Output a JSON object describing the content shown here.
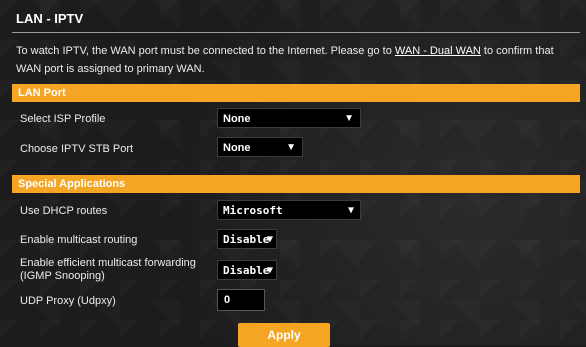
{
  "page": {
    "title": "LAN - IPTV",
    "description_prefix": "To watch IPTV, the WAN port must be connected to the Internet. Please go to ",
    "description_link": "WAN - Dual WAN",
    "description_suffix": " to confirm that WAN port is assigned to primary WAN."
  },
  "lan_port": {
    "heading": "LAN Port",
    "isp_profile": {
      "label": "Select ISP Profile",
      "value": "None"
    },
    "stb_port": {
      "label": "Choose IPTV STB Port",
      "value": "None"
    }
  },
  "special": {
    "heading": "Special Applications",
    "dhcp_routes": {
      "label": "Use DHCP routes",
      "value": "Microsoft"
    },
    "multicast_routing": {
      "label": "Enable multicast routing",
      "value": "Disable"
    },
    "igmp_snooping": {
      "label": "Enable efficient multicast forwarding (IGMP Snooping)",
      "value": "Disable"
    },
    "udp_proxy": {
      "label": "UDP Proxy (Udpxy)",
      "value": "0"
    }
  },
  "apply_label": "Apply",
  "colors": {
    "accent": "#f4a524",
    "background": "#1c1c1c"
  }
}
